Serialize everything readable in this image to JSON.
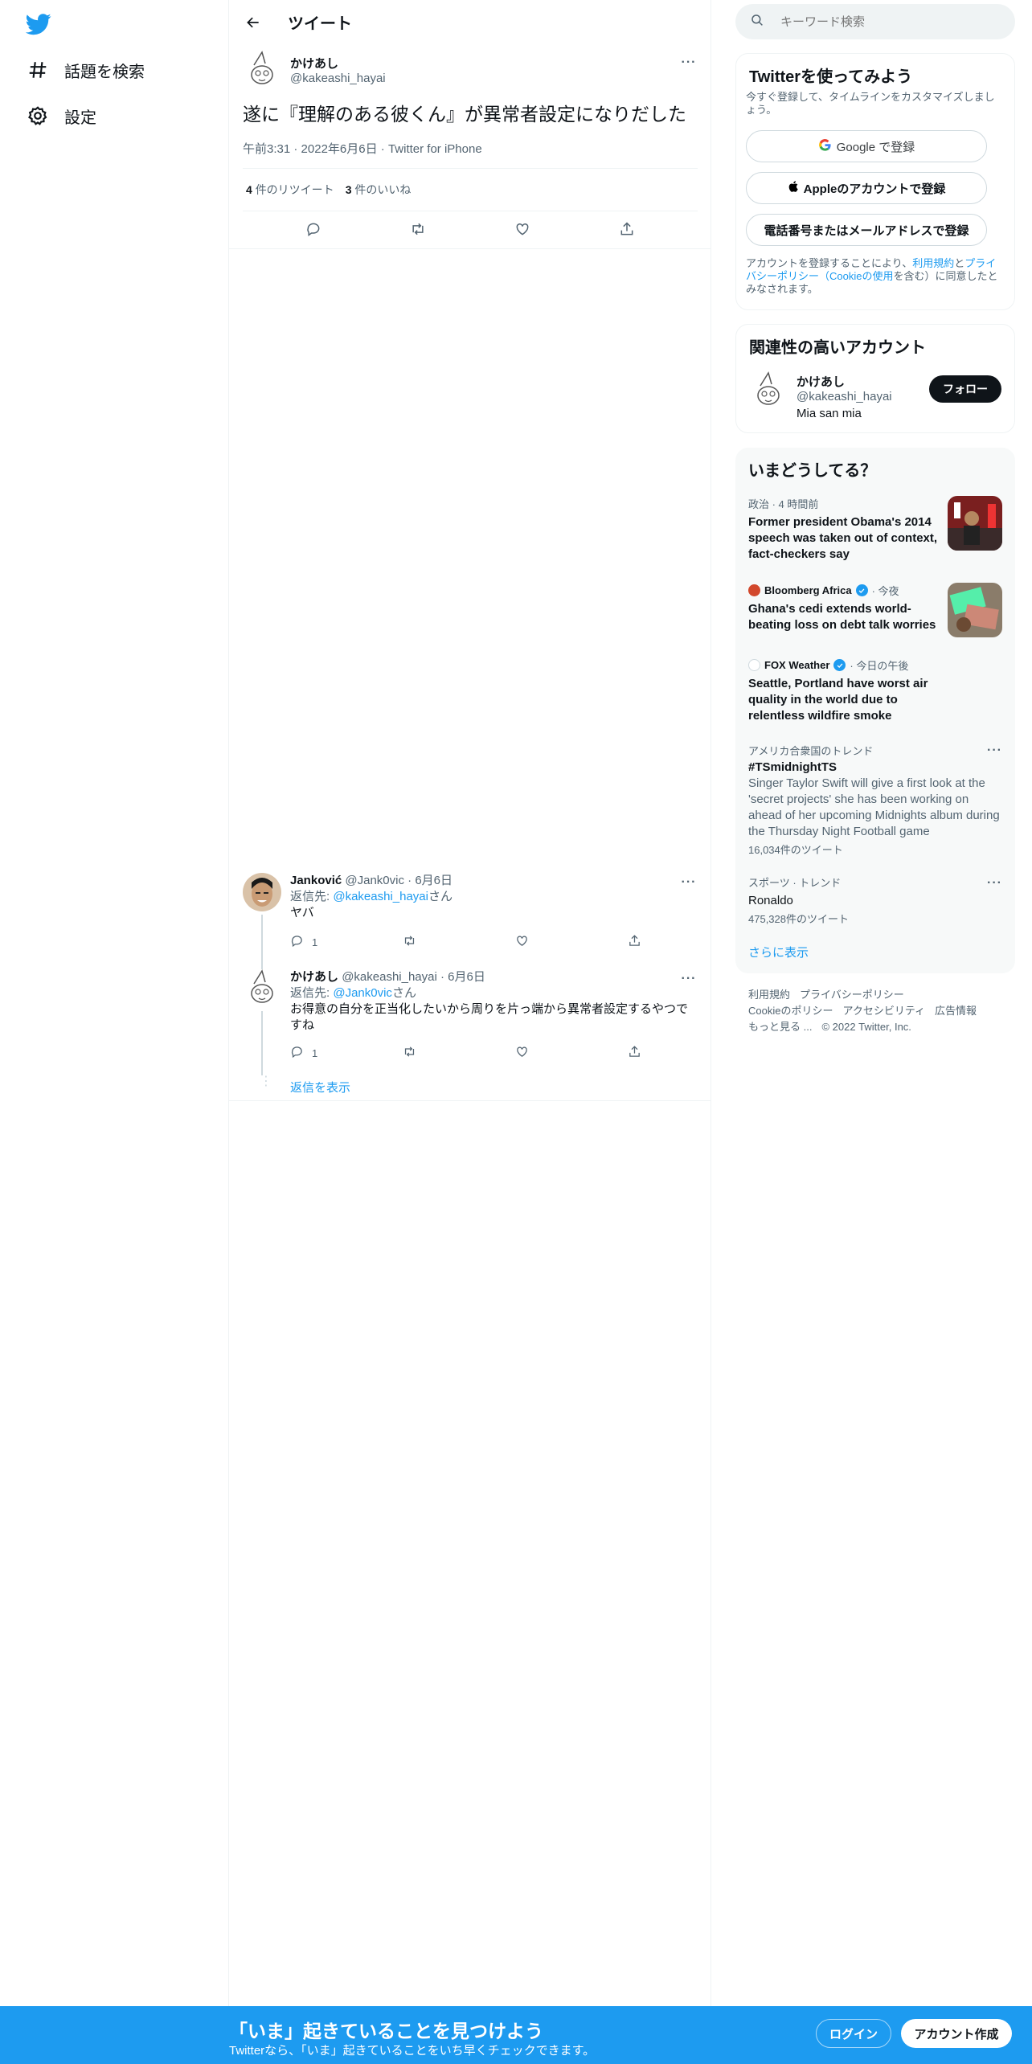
{
  "nav": {
    "explore_label": "話題を検索",
    "settings_label": "設定"
  },
  "header": {
    "title": "ツイート"
  },
  "tweet": {
    "name": "かけあし",
    "handle": "@kakeashi_hayai",
    "text": "遂に『理解のある彼くん』が異常者設定になりだした",
    "time": "午前3:31",
    "date": "2022年6月6日",
    "source": "Twitter for iPhone",
    "retweets_count": "4",
    "retweets_label": "件のリツイート",
    "likes_count": "3",
    "likes_label": "件のいいね"
  },
  "replies": [
    {
      "name": "Janković",
      "handle": "@Jank0vic",
      "date": "6月6日",
      "reply_prefix": "返信先: ",
      "reply_to": "@kakeashi_hayai",
      "reply_suffix": "さん",
      "text": "ヤバ",
      "reply_count": "1"
    },
    {
      "name": "かけあし",
      "handle": "@kakeashi_hayai",
      "date": "6月6日",
      "reply_prefix": "返信先: ",
      "reply_to": "@Jank0vic",
      "reply_suffix": "さん",
      "text": "お得意の自分を正当化したいから周りを片っ端から異常者設定するやつですね",
      "reply_count": "1"
    }
  ],
  "show_replies": "返信を表示",
  "search": {
    "placeholder": "キーワード検索"
  },
  "signup_card": {
    "title": "Twitterを使ってみよう",
    "subtitle": "今すぐ登録して、タイムラインをカスタマイズしましょう。",
    "google": "Google で登録",
    "apple": "Appleのアカウントで登録",
    "phone": "電話番号またはメールアドレスで登録",
    "legal_1": "アカウントを登録することにより、",
    "legal_terms": "利用規約",
    "legal_2": "と",
    "legal_privacy": "プライバシーポリシー（Cookieの使用",
    "legal_3": "を含む）に同意したとみなされます。"
  },
  "related": {
    "title": "関連性の高いアカウント",
    "name": "かけあし",
    "handle": "@kakeashi_hayai",
    "bio": "Mia san mia",
    "follow": "フォロー"
  },
  "trends": {
    "title": "いまどうしてる？",
    "items": [
      {
        "context": "政治 · 4 時間前",
        "title": "Former president Obama's 2014 speech was taken out of context, fact-checkers say"
      },
      {
        "source": "Bloomberg Africa",
        "time": "· 今夜",
        "title": "Ghana's cedi extends world-beating loss on debt talk worries"
      },
      {
        "source": "FOX Weather",
        "time": "· 今日の午後",
        "title": "Seattle, Portland have worst air quality in the world due to relentless wildfire smoke"
      },
      {
        "context": "アメリカ合衆国のトレンド",
        "title": "#TSmidnightTS",
        "desc": "Singer Taylor Swift will give a first look at the 'secret projects' she has been working on ahead of her upcoming Midnights album during the Thursday Night Football game",
        "count": "16,034件のツイート"
      },
      {
        "context": "スポーツ · トレンド",
        "title": "Ronaldo",
        "count": "475,328件のツイート"
      }
    ],
    "show_more": "さらに表示"
  },
  "footer": {
    "terms": "利用規約",
    "privacy": "プライバシーポリシー",
    "cookie": "Cookieのポリシー",
    "access": "アクセシビリティ",
    "ads": "広告情報",
    "more": "もっと見る ...",
    "copyright": "© 2022 Twitter, Inc."
  },
  "bottom": {
    "title": "「いま」起きていることを見つけよう",
    "subtitle": "Twitterなら、「いま」起きていることをいち早くチェックできます。",
    "login": "ログイン",
    "signup": "アカウント作成"
  },
  "colors": {
    "brand": "#1d9bf0",
    "text": "#0f1419",
    "muted": "#536471"
  }
}
